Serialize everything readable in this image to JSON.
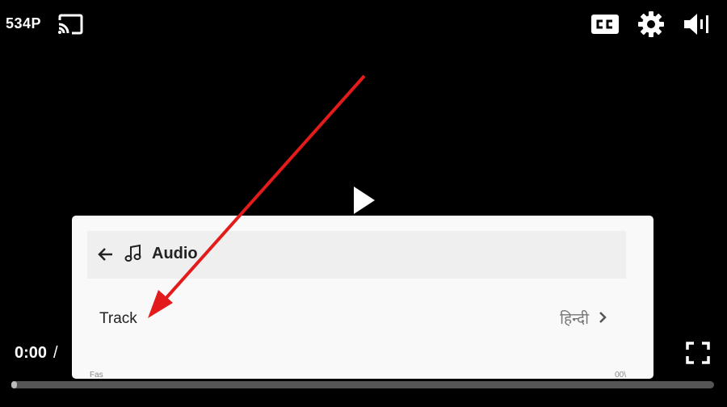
{
  "top_bar": {
    "quality": "534P",
    "icons": [
      "cast-icon",
      "closed-captions-icon",
      "settings-gear-icon",
      "volume-icon"
    ]
  },
  "center": {
    "icon": "play-icon"
  },
  "controls": {
    "current_time": "0:00",
    "separator": "/",
    "progress": 0.0,
    "fullscreen_icon": "fullscreen-icon"
  },
  "settings_panel": {
    "title": "Audio",
    "back_icon": "arrow-left-icon",
    "title_icon": "music-note-icon",
    "rows": [
      {
        "label": "Track",
        "value": "हिन्दी"
      }
    ],
    "partial_hint_left": "Fas ",
    "partial_hint_right": "00\\"
  },
  "annotation": {
    "color": "#e31b1b"
  },
  "colors": {
    "background": "#000000",
    "panel": "#f9f9f9",
    "panel_header": "#efefef",
    "progress_track": "#555555"
  }
}
